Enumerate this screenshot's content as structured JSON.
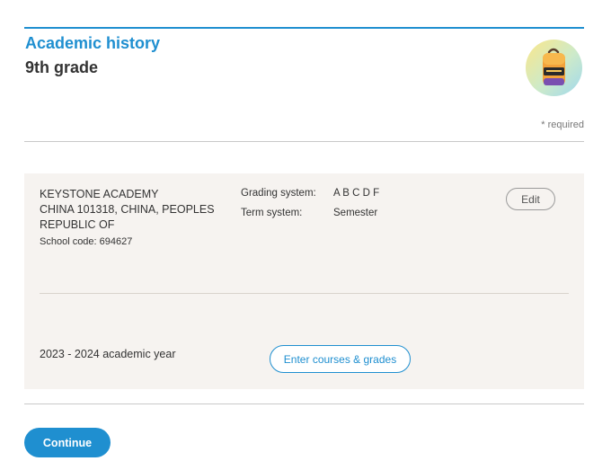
{
  "header": {
    "title": "Academic history",
    "subtitle": "9th grade",
    "avatar_icon": "backpack-icon",
    "required_note": "* required"
  },
  "school": {
    "name_line1": "KEYSTONE ACADEMY",
    "name_line2": "CHINA 101318, CHINA, PEOPLES",
    "name_line3": "REPUBLIC OF",
    "code": "School code: 694627",
    "grading_label": "Grading system:",
    "grading_value": "A B C D F",
    "term_label": "Term system:",
    "term_value": "Semester",
    "edit_label": "Edit"
  },
  "year": {
    "label": "2023 - 2024 academic year",
    "courses_button": "Enter courses & grades"
  },
  "footer": {
    "continue_label": "Continue"
  },
  "colors": {
    "accent": "#1f8fd0",
    "card_background": "#f6f3f0"
  }
}
